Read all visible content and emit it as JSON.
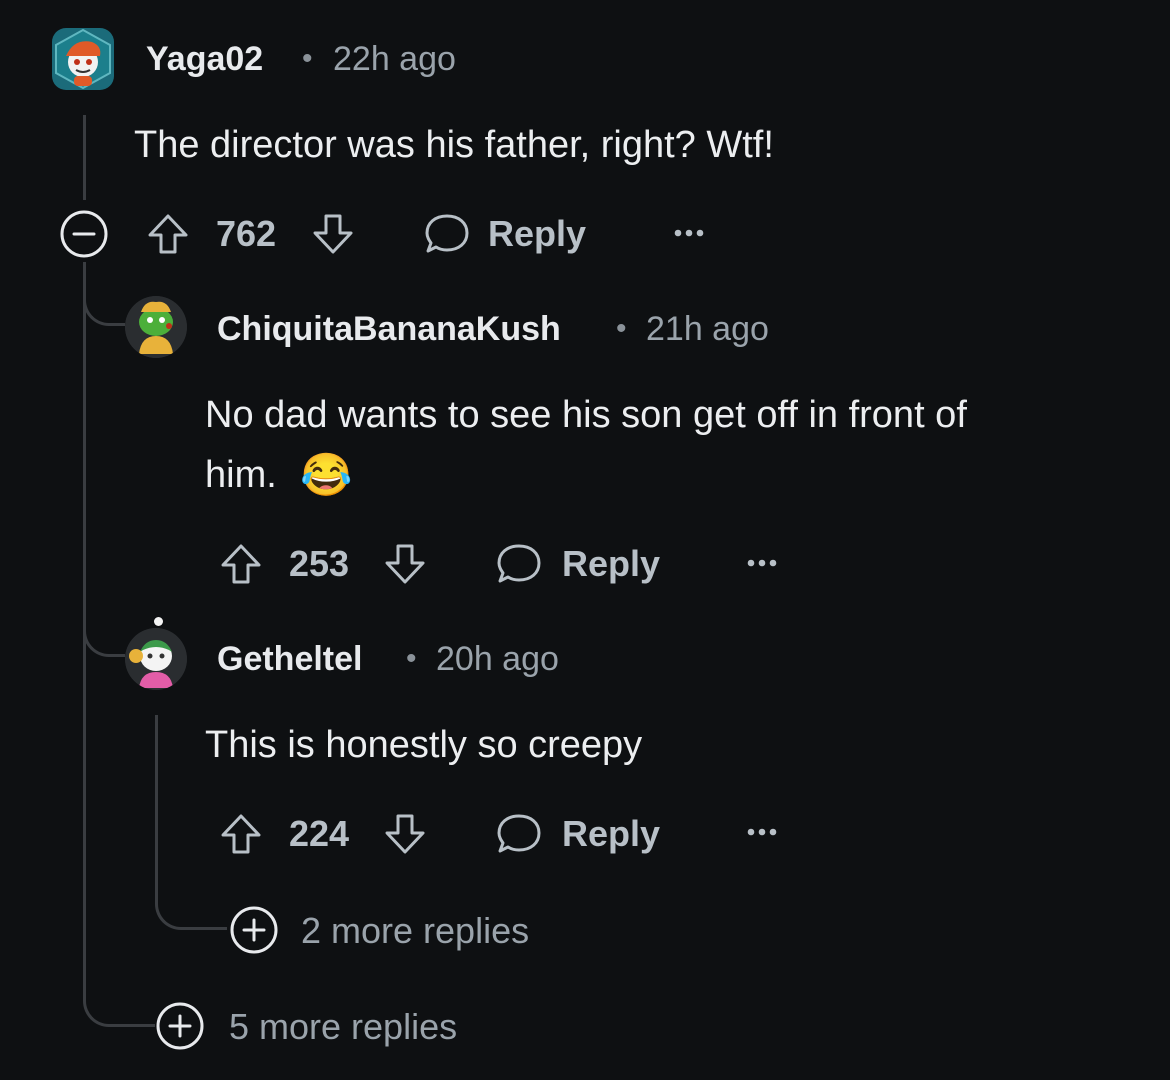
{
  "comments": [
    {
      "username": "Yaga02",
      "separator": "•",
      "time": "22h ago",
      "text": "The director was his father, right? Wtf!",
      "votes": "762",
      "reply_label": "Reply"
    },
    {
      "username": "ChiquitaBananaKush",
      "separator": "•",
      "time": "21h ago",
      "text_line1": "No dad wants to see his son get off in front of",
      "text_line2": "him.",
      "emoji": "😂",
      "votes": "253",
      "reply_label": "Reply"
    },
    {
      "username": "Getheltel",
      "separator": "•",
      "time": "20h ago",
      "text": "This is honestly so creepy",
      "votes": "224",
      "reply_label": "Reply"
    }
  ],
  "more_replies_nested": "2 more replies",
  "more_replies_top": "5 more replies",
  "icons": {
    "collapse": "minus-circle-icon",
    "upvote": "arrow-up-icon",
    "downvote": "arrow-down-icon",
    "reply": "speech-bubble-icon",
    "overflow": "ellipsis-icon",
    "expand": "plus-circle-icon"
  },
  "colors": {
    "background": "#0e1012",
    "text": "#e8eaed",
    "muted": "#9aa3ab",
    "action": "#b8c0c7",
    "thread_line": "#3a3d41"
  }
}
